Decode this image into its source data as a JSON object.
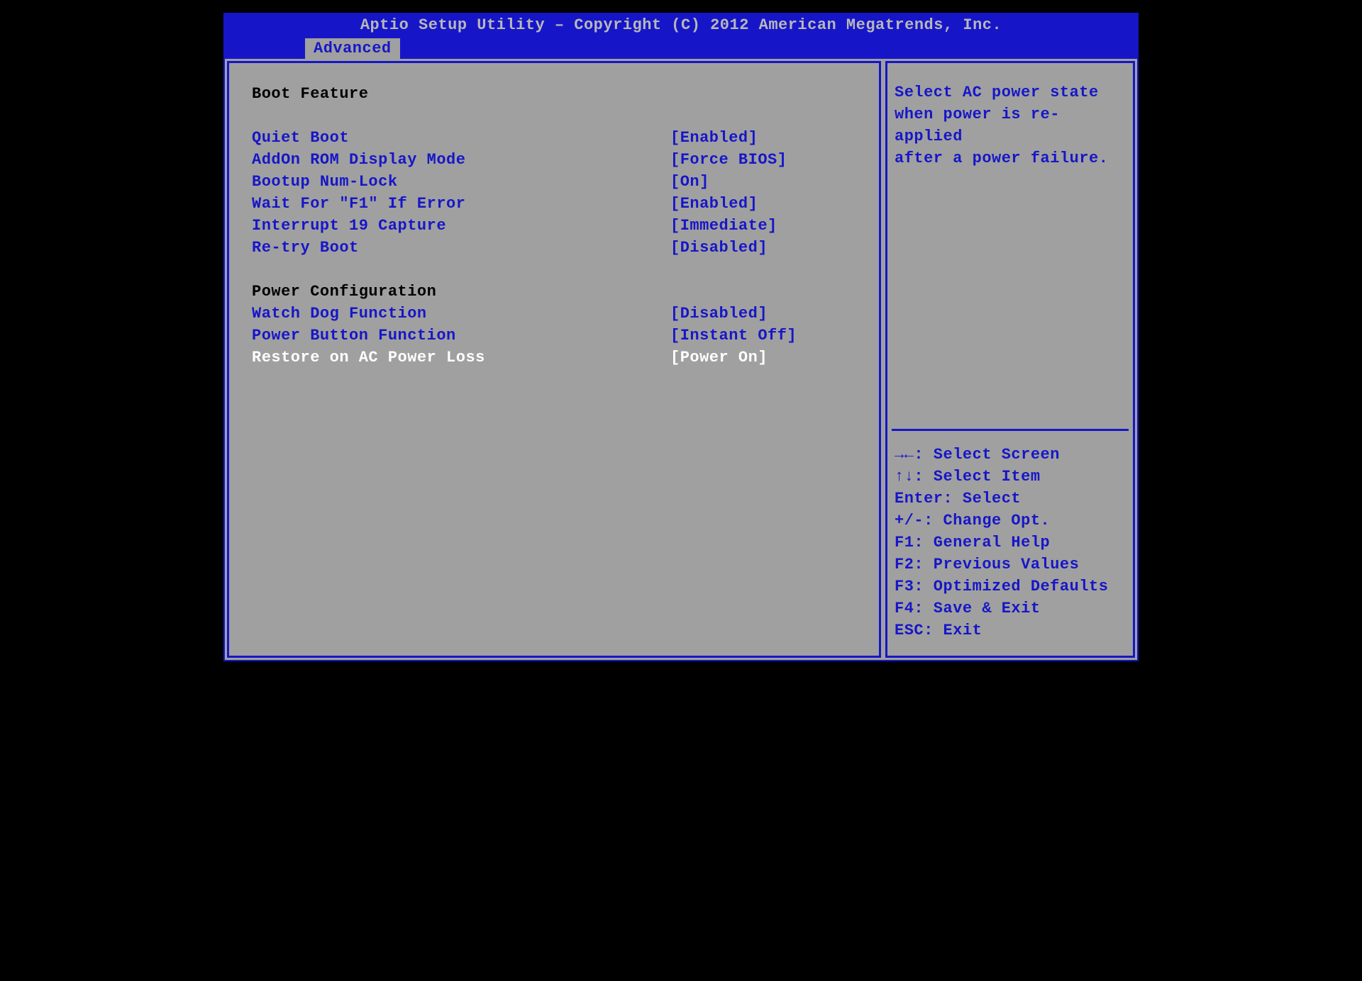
{
  "title": "Aptio Setup Utility – Copyright (C) 2012 American Megatrends, Inc.",
  "tab": "Advanced",
  "sections": {
    "boot_header": "Boot Feature",
    "power_header": "Power Configuration"
  },
  "settings": {
    "quiet_boot": {
      "label": "Quiet Boot",
      "value": "[Enabled]"
    },
    "addon_rom": {
      "label": "AddOn ROM Display Mode",
      "value": "[Force BIOS]"
    },
    "numlock": {
      "label": "Bootup Num-Lock",
      "value": "[On]"
    },
    "wait_f1": {
      "label": "Wait For \"F1\" If Error",
      "value": "[Enabled]"
    },
    "int19": {
      "label": "Interrupt 19 Capture",
      "value": "[Immediate]"
    },
    "retry_boot": {
      "label": "Re-try Boot",
      "value": "[Disabled]"
    },
    "watchdog": {
      "label": "Watch Dog Function",
      "value": "[Disabled]"
    },
    "power_button": {
      "label": "Power Button Function",
      "value": "[Instant Off]"
    },
    "ac_loss": {
      "label": "Restore on AC Power Loss",
      "value": "[Power On]"
    }
  },
  "help_text": {
    "line1": "Select AC power state",
    "line2": "when power is re-applied",
    "line3": "after a power failure."
  },
  "key_help": {
    "k1": "→←: Select Screen",
    "k2": "↑↓: Select Item",
    "k3": "Enter: Select",
    "k4": "+/-: Change Opt.",
    "k5": "F1: General Help",
    "k6": "F2: Previous Values",
    "k7": "F3: Optimized Defaults",
    "k8": "F4: Save & Exit",
    "k9": "ESC: Exit"
  }
}
